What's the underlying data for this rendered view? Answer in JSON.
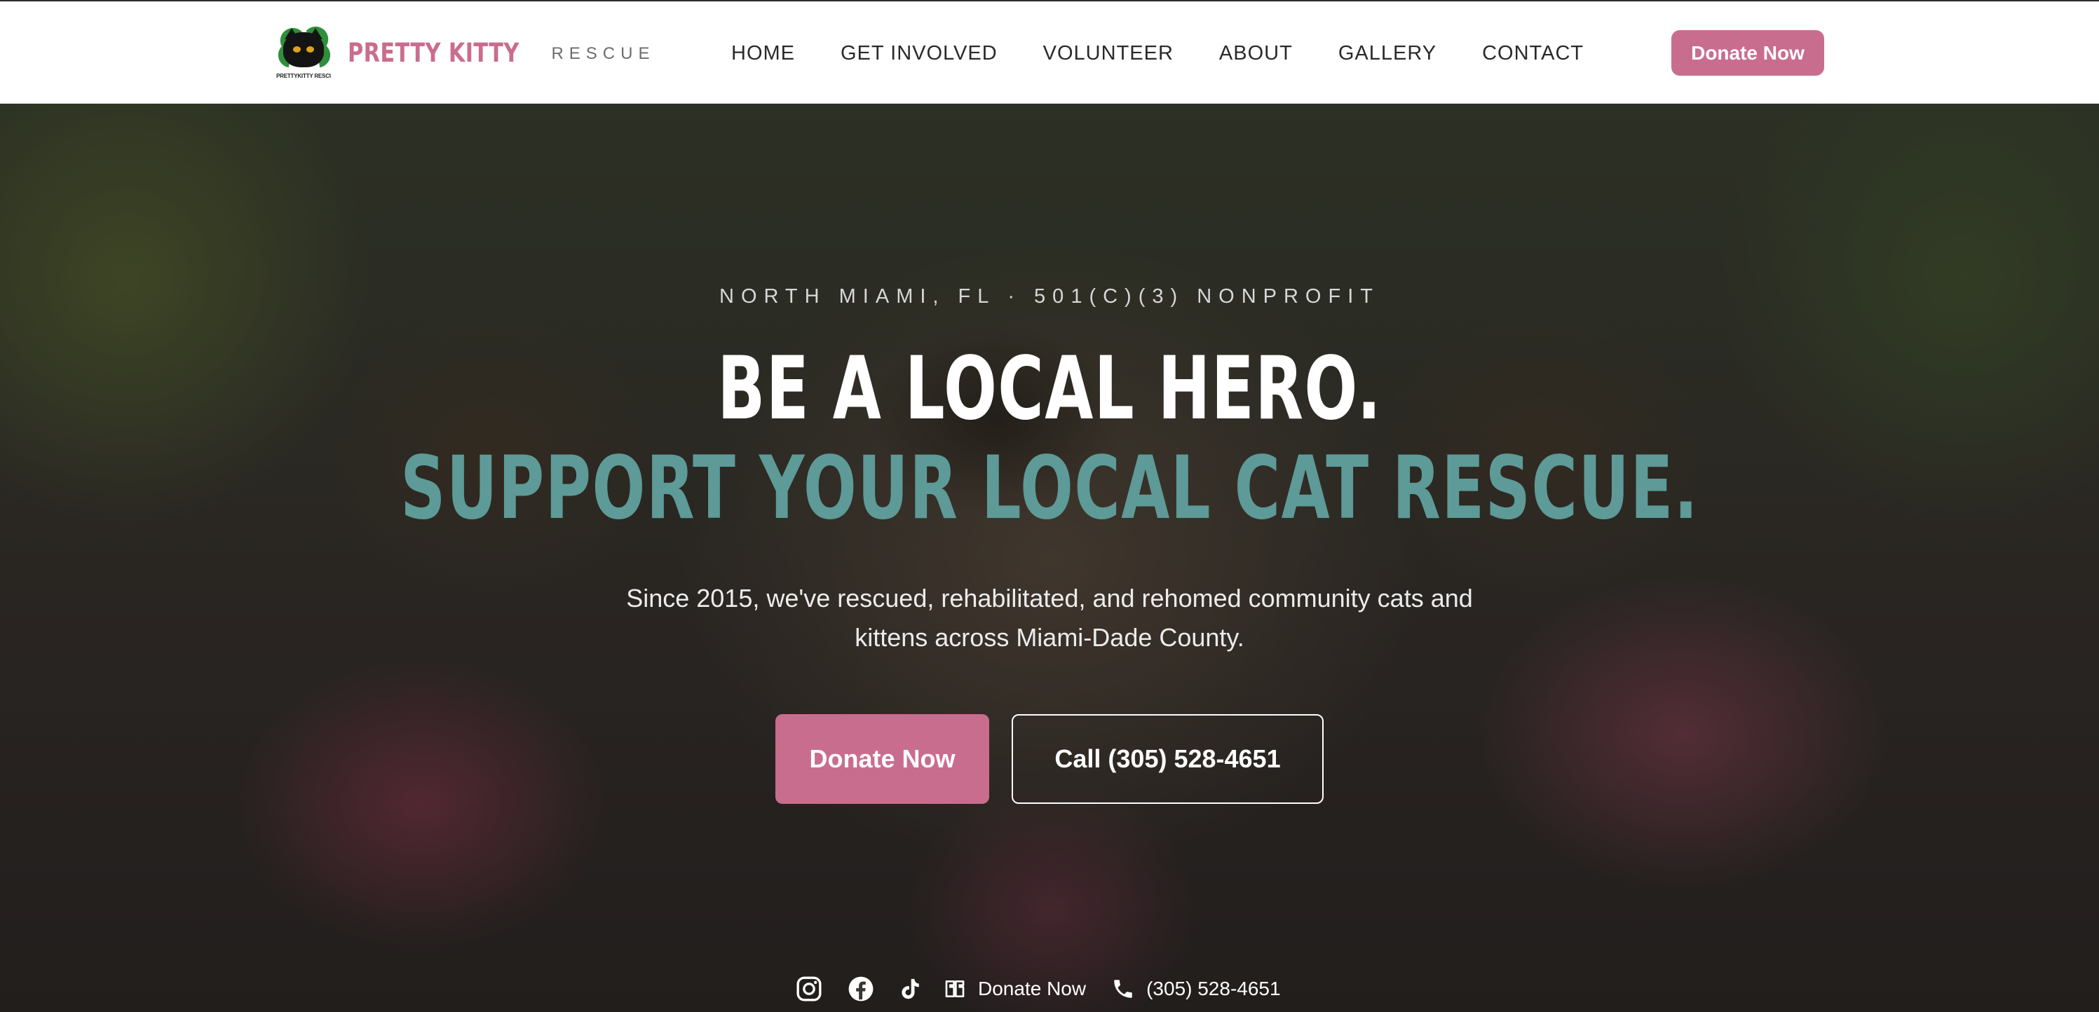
{
  "header": {
    "brand_name": "PRETTY KITTY",
    "brand_sub": "RESCUE",
    "logo_caption": "PRETTYKITTY RESCUE",
    "donate_label": "Donate Now"
  },
  "nav": {
    "items": [
      {
        "label": "HOME"
      },
      {
        "label": "GET INVOLVED"
      },
      {
        "label": "VOLUNTEER"
      },
      {
        "label": "ABOUT"
      },
      {
        "label": "GALLERY"
      },
      {
        "label": "CONTACT"
      }
    ]
  },
  "hero": {
    "eyebrow": "NORTH MIAMI, FL · 501(C)(3) NONPROFIT",
    "headline_line1": "BE A LOCAL HERO.",
    "headline_line2": "SUPPORT YOUR LOCAL CAT RESCUE.",
    "lead": "Since 2015, we've rescued, rehabilitated, and rehomed community cats and kittens across Miami-Dade County.",
    "cta_primary": "Donate Now",
    "cta_secondary": "Call (305) 528-4651",
    "socials": {
      "icons": [
        "instagram-icon",
        "facebook-icon",
        "tiktok-icon",
        "givebutter-icon",
        "phone-icon"
      ],
      "donate_label": "Donate Now",
      "phone_label": "(305) 528-4651"
    }
  },
  "colors": {
    "brand_pink": "#c96d8e",
    "brand_teal": "#5e9a97",
    "nav_text": "#2a2a2a",
    "white": "#ffffff"
  }
}
